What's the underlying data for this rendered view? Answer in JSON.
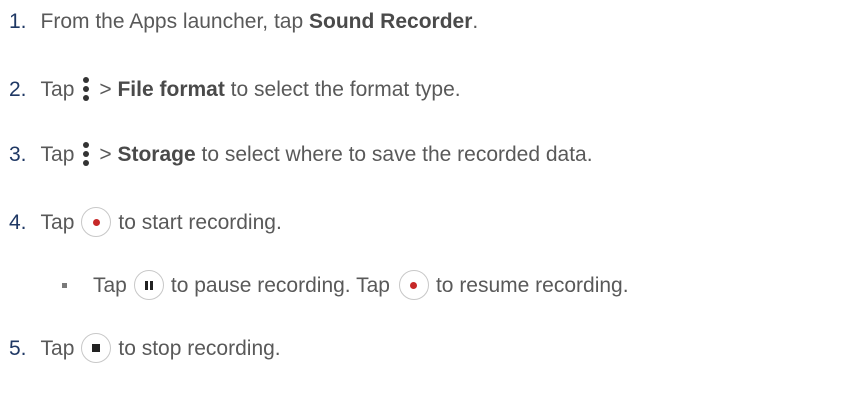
{
  "steps": {
    "s1": {
      "num": "1.",
      "pre": "From the Apps launcher, tap ",
      "bold": "Sound Recorder",
      "post": "."
    },
    "s2": {
      "num": "2.",
      "pre": "Tap",
      "gt": "> ",
      "bold": "File format",
      "post": " to select the format type.",
      "icon": "more-options-icon"
    },
    "s3": {
      "num": "3.",
      "pre": "Tap",
      "gt": "> ",
      "bold": "Storage",
      "post": " to select where to save the recorded data.",
      "icon": "more-options-icon"
    },
    "s4": {
      "num": "4.",
      "pre": "Tap",
      "post": "to start recording.",
      "icon": "record-icon"
    },
    "sub": {
      "pre": "Tap",
      "mid": "to pause recording. Tap",
      "post": "to resume recording.",
      "icons": [
        "pause-icon",
        "record-icon"
      ]
    },
    "s5": {
      "num": "5.",
      "pre": "Tap",
      "post": "to stop recording.",
      "icon": "stop-icon"
    }
  },
  "colors": {
    "text": "#595959",
    "number": "#1f3864",
    "record": "#c62828"
  }
}
